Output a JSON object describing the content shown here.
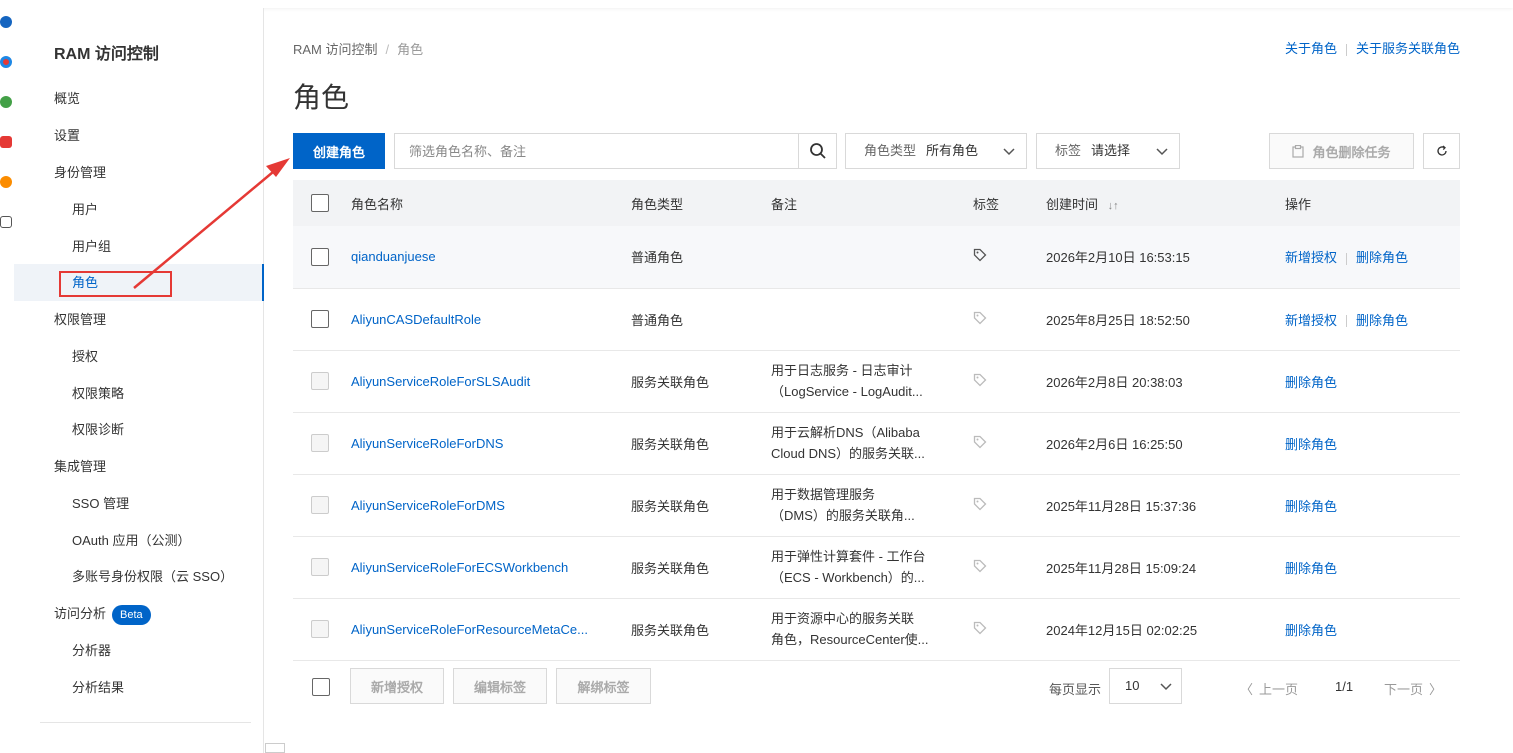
{
  "sidebar": {
    "title": "RAM 访问控制",
    "items": [
      {
        "label": "概览"
      },
      {
        "label": "设置"
      },
      {
        "label": "身份管理"
      },
      {
        "label": "用户"
      },
      {
        "label": "用户组"
      },
      {
        "label": "角色"
      },
      {
        "label": "权限管理"
      },
      {
        "label": "授权"
      },
      {
        "label": "权限策略"
      },
      {
        "label": "权限诊断"
      },
      {
        "label": "集成管理"
      },
      {
        "label": "SSO 管理"
      },
      {
        "label": "OAuth 应用（公测）"
      },
      {
        "label": "多账号身份权限（云 SSO）"
      },
      {
        "label": "访问分析",
        "badge": "Beta"
      },
      {
        "label": "分析器"
      },
      {
        "label": "分析结果"
      }
    ]
  },
  "breadcrumb": {
    "root": "RAM 访问控制",
    "sep": "/",
    "current": "角色"
  },
  "top_links": {
    "about_roles": "关于角色",
    "about_service_roles": "关于服务关联角色"
  },
  "page_title": "角色",
  "toolbar": {
    "create_label": "创建角色",
    "search_placeholder": "筛选角色名称、备注",
    "role_type_label": "角色类型",
    "role_type_value": "所有角色",
    "tag_label": "标签",
    "tag_value": "请选择",
    "delete_task_label": "角色删除任务"
  },
  "table": {
    "headers": {
      "name": "角色名称",
      "type": "角色类型",
      "note": "备注",
      "tag": "标签",
      "created": "创建时间",
      "sort_icon": "↓↑",
      "ops": "操作"
    },
    "rows": [
      {
        "name": "qianduanjuese",
        "type": "普通角色",
        "note1": "",
        "note2": "",
        "created": "2026年2月10日 16:53:15",
        "op_grant": "新增授权",
        "op_delete": "删除角色"
      },
      {
        "name": "AliyunCASDefaultRole",
        "type": "普通角色",
        "note1": "",
        "note2": "",
        "created": "2025年8月25日 18:52:50",
        "op_grant": "新增授权",
        "op_delete": "删除角色"
      },
      {
        "name": "AliyunServiceRoleForSLSAudit",
        "type": "服务关联角色",
        "note1": "用于日志服务 - 日志审计",
        "note2": "（LogService - LogAudit...",
        "created": "2026年2月8日 20:38:03",
        "op_grant": "",
        "op_delete": "删除角色"
      },
      {
        "name": "AliyunServiceRoleForDNS",
        "type": "服务关联角色",
        "note1": "用于云解析DNS（Alibaba",
        "note2": "Cloud DNS）的服务关联...",
        "created": "2026年2月6日 16:25:50",
        "op_grant": "",
        "op_delete": "删除角色"
      },
      {
        "name": "AliyunServiceRoleForDMS",
        "type": "服务关联角色",
        "note1": "用于数据管理服务",
        "note2": "（DMS）的服务关联角...",
        "created": "2025年11月28日 15:37:36",
        "op_grant": "",
        "op_delete": "删除角色"
      },
      {
        "name": "AliyunServiceRoleForECSWorkbench",
        "type": "服务关联角色",
        "note1": "用于弹性计算套件 - 工作台",
        "note2": "（ECS - Workbench）的...",
        "created": "2025年11月28日 15:09:24",
        "op_grant": "",
        "op_delete": "删除角色"
      },
      {
        "name": "AliyunServiceRoleForResourceMetaCe...",
        "type": "服务关联角色",
        "note1": "用于资源中心的服务关联",
        "note2": "角色，ResourceCenter使...",
        "created": "2024年12月15日 02:02:25",
        "op_grant": "",
        "op_delete": "删除角色"
      }
    ]
  },
  "footer": {
    "add_grant": "新增授权",
    "edit_tags": "编辑标签",
    "unbind_tags": "解绑标签",
    "per_page_label": "每页显示",
    "per_page_value": "10",
    "prev": "上一页",
    "page_info": "1/1",
    "next": "下一页"
  },
  "colors": {
    "accent": "#0064c8",
    "annotation": "#e53935"
  }
}
